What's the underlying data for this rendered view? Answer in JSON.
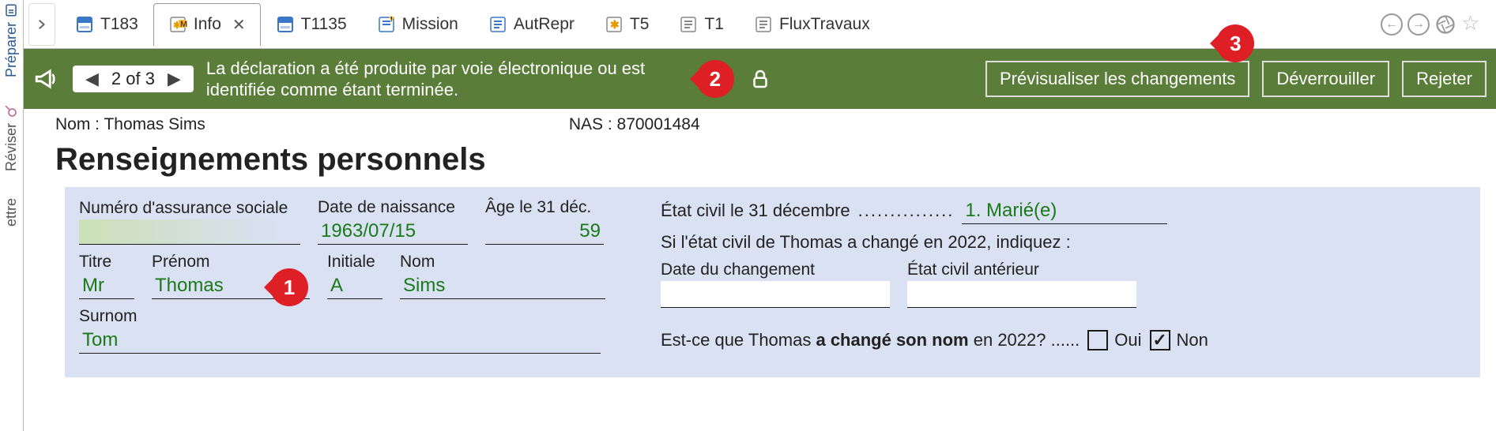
{
  "sidebar": {
    "items": [
      {
        "label": "Préparer"
      },
      {
        "label": "Réviser"
      },
      {
        "label": "ettre"
      }
    ]
  },
  "tabs": {
    "items": [
      {
        "label": "T183",
        "iconName": "form-blue-icon"
      },
      {
        "label": "Info",
        "iconName": "form-star-m-icon",
        "active": true,
        "close": "✕"
      },
      {
        "label": "T1135",
        "iconName": "form-blue-icon"
      },
      {
        "label": "Mission",
        "iconName": "form-warning-icon"
      },
      {
        "label": "AutRepr",
        "iconName": "form-lines-icon"
      },
      {
        "label": "T5",
        "iconName": "form-star-icon"
      },
      {
        "label": "T1",
        "iconName": "form-lines-icon"
      },
      {
        "label": "FluxTravaux",
        "iconName": "form-lines-icon"
      }
    ]
  },
  "greenbar": {
    "pager": {
      "prev": "◀",
      "text": "2 of 3",
      "next": "▶"
    },
    "message": "La déclaration a été produite par voie électronique ou est identifiée comme étant terminée.",
    "buttons": {
      "preview": "Prévisualiser les changements",
      "unlock": "Déverrouiller",
      "reject": "Rejeter"
    }
  },
  "annotations": {
    "a1": "1",
    "a2": "2",
    "a3": "3"
  },
  "header": {
    "nameLabel": "Nom : ",
    "nameValue": "Thomas Sims",
    "nasLabel": "NAS : ",
    "nasValue": "870001484",
    "sectionTitle": "Renseignements personnels"
  },
  "form": {
    "sinLabel": "Numéro d'assurance sociale",
    "sinValue": "",
    "dobLabel": "Date de naissance",
    "dobValue": "1963/07/15",
    "ageLabel": "Âge le 31 déc.",
    "ageValue": "59",
    "titleLabel": "Titre",
    "titleValue": "Mr",
    "firstLabel": "Prénom",
    "firstValue": "Thomas",
    "initialLabel": "Initiale",
    "initialValue": "A",
    "lastLabel": "Nom",
    "lastValue": "Sims",
    "nickLabel": "Surnom",
    "nickValue": "Tom",
    "maritalLabel": "État civil le 31 décembre ",
    "maritalDots": "...............",
    "maritalValue": "1. Marié(e)",
    "maritalChanged": "Si l'état civil de Thomas a changé en 2022, indiquez :",
    "changeDateLabel": "Date du changement",
    "prevMaritalLabel": "État civil antérieur",
    "nameChangedQ_a": "Est-ce que Thomas ",
    "nameChangedQ_b": "a changé son nom",
    "nameChangedQ_c": " en 2022? ......",
    "yes": "Oui",
    "no": "Non",
    "noCheck": "✓"
  }
}
